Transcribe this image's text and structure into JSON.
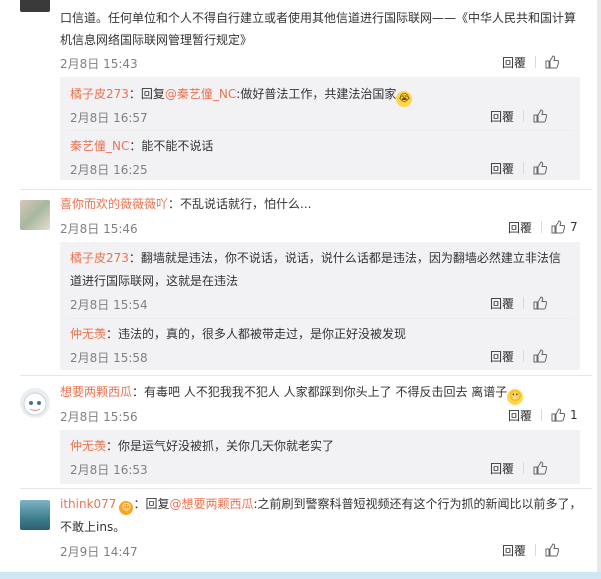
{
  "c1": {
    "text_line1": "口信道。任何单位和个人不得自行建立或者使用其他信道进行国际联网——《中华人民共和国计算",
    "text_line2": "机信息网络国际联网管理暂行规定》",
    "time": "2月8日 15:43",
    "reply_label": "回覆",
    "like_count": ""
  },
  "r1": {
    "user": "橘子皮273",
    "prefix": "：回复",
    "mention": "@秦艺僮_NC",
    "text": ":做好普法工作，共建法治国家",
    "time": "2月8日 16:57",
    "reply_label": "回覆"
  },
  "r2": {
    "user": "秦艺僮_NC",
    "text": "：能不能不说话",
    "time": "2月8日 16:25",
    "reply_label": "回覆"
  },
  "c2": {
    "user": "喜你而欢的薇薇薇吖",
    "text": "：不乱说话就行，怕什么...",
    "time": "2月8日 15:46",
    "reply_label": "回覆",
    "like_count": "7"
  },
  "r3": {
    "user": "橘子皮273",
    "text_line1": "：翻墙就是违法，你不说话，说话，说什么话都是违法，因为翻墙必然建立非法信",
    "text_line2": "道进行国际联网，这就是在违法",
    "time": "2月8日 15:54",
    "reply_label": "回覆"
  },
  "r4": {
    "user": "仲无羡",
    "text": "：违法的，真的，很多人都被带走过，是你正好没被发现",
    "time": "2月8日 15:58",
    "reply_label": "回覆"
  },
  "c3": {
    "user": "想要两颗西瓜",
    "text": "：有毒吧 人不犯我我不犯人 人家都踩到你头上了 不得反击回去 离谱子",
    "time": "2月8日 15:56",
    "reply_label": "回覆",
    "like_count": "1"
  },
  "r5": {
    "user": "仲无羡",
    "text": "：你是运气好没被抓，关你几天你就老实了",
    "time": "2月8日 16:53",
    "reply_label": "回覆"
  },
  "c4": {
    "user": "ithink077",
    "prefix": "：回复",
    "mention": "@想要两颗西瓜",
    "text_line1": ":之前刷到警察科普短视频还有这个行为抓的新闻比以前多了，",
    "text_line2": "不敢上ins。",
    "time": "2月9日 14:47",
    "reply_label": "回覆"
  },
  "colors": {
    "name": "#eb7350",
    "panel": "#f2f2f5",
    "time": "#808080"
  }
}
